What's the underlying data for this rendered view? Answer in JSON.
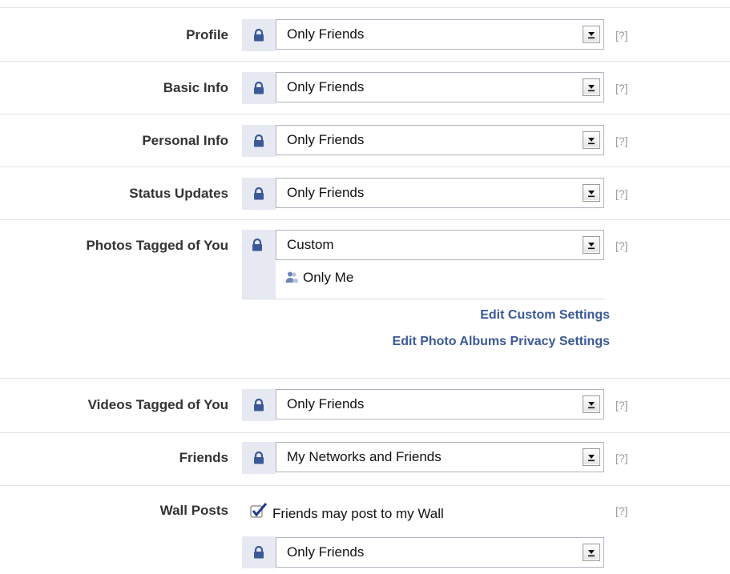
{
  "help_label": "[?]",
  "colors": {
    "accent": "#3b5998",
    "lock_bg": "#e6e9f2",
    "divider": "#e2e5ec"
  },
  "rows": [
    {
      "label": "Profile",
      "value": "Only Friends"
    },
    {
      "label": "Basic Info",
      "value": "Only Friends"
    },
    {
      "label": "Personal Info",
      "value": "Only Friends"
    },
    {
      "label": "Status Updates",
      "value": "Only Friends"
    },
    {
      "label": "Photos Tagged of You",
      "value": "Custom",
      "custom_entry": "Only Me"
    },
    {
      "label": "Videos Tagged of You",
      "value": "Only Friends"
    },
    {
      "label": "Friends",
      "value": "My Networks and Friends"
    },
    {
      "label": "Wall Posts",
      "checkbox_label": "Friends may post to my Wall",
      "checkbox_checked": true,
      "value": "Only Friends"
    }
  ],
  "links": {
    "edit_custom": "Edit Custom Settings",
    "edit_albums": "Edit Photo Albums Privacy Settings"
  },
  "icons": {
    "lock": "lock-icon",
    "person": "person-icon",
    "dropdown": "dropdown-arrow-icon",
    "checkbox": "checkbox-icon"
  }
}
